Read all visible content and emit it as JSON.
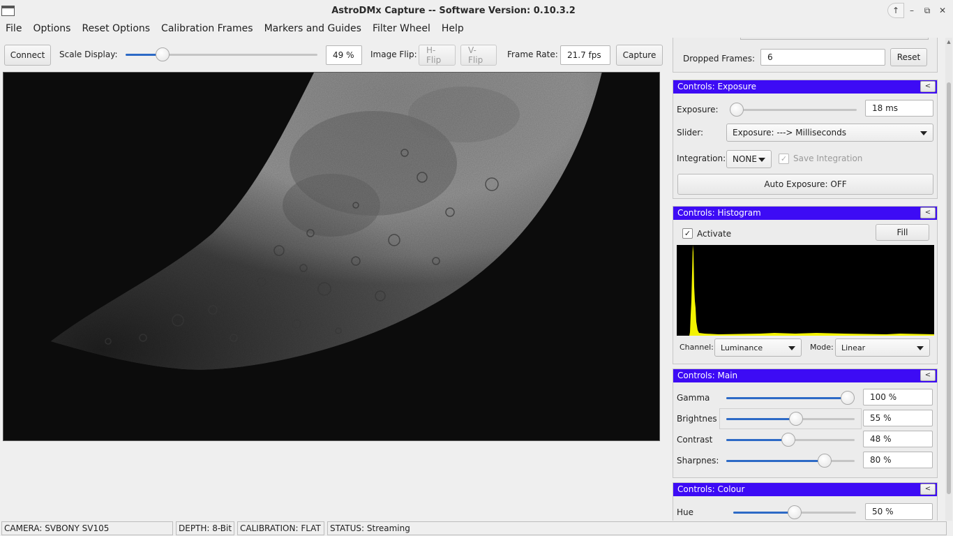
{
  "window": {
    "title": "AstroDMx Capture -- Software Version: 0.10.3.2"
  },
  "menu": [
    "File",
    "Options",
    "Reset Options",
    "Calibration Frames",
    "Markers and Guides",
    "Filter Wheel",
    "Help"
  ],
  "toolbar": {
    "connect_label": "Connect",
    "scale_label": "Scale Display:",
    "scale_value": "49 %",
    "scale_level": 0.17,
    "flip_label": "Image Flip:",
    "hflip_label": "H-Flip",
    "vflip_label": "V-Flip",
    "framerate_label": "Frame Rate:",
    "framerate_value": "21.7 fps",
    "capture_label": "Capture"
  },
  "dropped": {
    "label": "Dropped Frames:",
    "value": "6",
    "reset_label": "Reset"
  },
  "exposure": {
    "title": "Controls: Exposure",
    "collapse": "<",
    "exposure_label": "Exposure:",
    "exposure_value": "18 ms",
    "exposure_level": 0.0,
    "slider_label": "Slider:",
    "slider_mode": "Exposure: ---> Milliseconds",
    "integration_label": "Integration:",
    "integration_value": "NONE",
    "save_integration_label": "Save Integration",
    "auto_exposure_label": "Auto Exposure: OFF"
  },
  "histogram": {
    "title": "Controls: Histogram",
    "collapse": "<",
    "activate_label": "Activate",
    "fill_label": "Fill",
    "channel_label": "Channel:",
    "channel_value": "Luminance",
    "mode_label": "Mode:",
    "mode_value": "Linear",
    "bar_color": "#f3f300"
  },
  "main_controls": {
    "title": "Controls: Main",
    "collapse": "<",
    "sliders": [
      {
        "label": "Gamma",
        "value": "100 %",
        "level": 1.0
      },
      {
        "label": "Brightnes",
        "value": "55 %",
        "level": 0.55
      },
      {
        "label": "Contrast",
        "value": "48 %",
        "level": 0.48
      },
      {
        "label": "Sharpnes:",
        "value": "80 %",
        "level": 0.8
      }
    ]
  },
  "colour": {
    "title": "Controls: Colour",
    "collapse": "<",
    "hue_label": "Hue",
    "hue_value": "50 %",
    "hue_level": 0.5
  },
  "status": {
    "camera": "CAMERA: SVBONY SV105",
    "depth": "DEPTH: 8-Bit",
    "calibration": "CALIBRATION: FLAT",
    "state": "STATUS: Streaming"
  },
  "colors": {
    "section_header": "#3d0bf5",
    "slider_fill": "#2d6ac6"
  }
}
